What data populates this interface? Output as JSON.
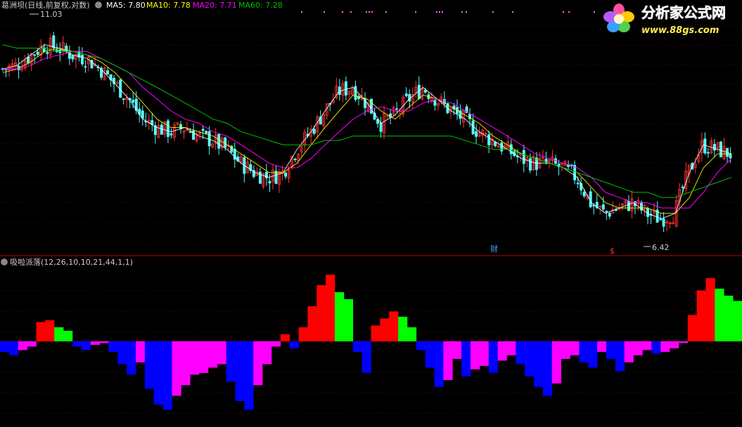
{
  "header": {
    "stock_title": "葛洲坝(日线,前复权,对数)",
    "ma5": "MA5: 7.80",
    "ma10": "MA10: 7.78",
    "ma20": "MA20: 7.71",
    "ma60": "MA60: 7.28"
  },
  "indicator": {
    "title": "吸啦派落(12,26,10,10,21,44,1,1)"
  },
  "annotations": {
    "high_label": "11.03",
    "low_label": "6.42",
    "event_cai": "财",
    "event_dollar": "$"
  },
  "logo": {
    "brand": "分析家公式网",
    "url": "www.88gs.com"
  },
  "colors": {
    "background": "#000000",
    "up_candle": "#ff3232",
    "down_candle": "#54ffff",
    "ma5": "#ffffff",
    "ma10": "#ffff00",
    "ma20": "#ff00ff",
    "ma60": "#00c000",
    "bar_red": "#ff0000",
    "bar_green": "#00ff00",
    "bar_blue": "#0000ff",
    "bar_magenta": "#ff00ff",
    "separator": "#c00000"
  },
  "chart_data": [
    {
      "type": "line",
      "panel": "price",
      "scale": "log",
      "ylim": [
        6.0,
        11.6
      ],
      "series": [
        {
          "name": "MA5",
          "values": [
            9.9,
            10.0,
            10.3,
            10.6,
            10.5,
            10.3,
            10.2,
            9.9,
            9.5,
            9.1,
            8.6,
            8.4,
            8.3,
            8.4,
            8.2,
            8.1,
            7.9,
            7.6,
            7.4,
            7.3,
            7.4,
            7.9,
            8.3,
            8.8,
            9.3,
            9.4,
            9.0,
            8.5,
            8.7,
            9.1,
            9.4,
            9.1,
            8.8,
            8.6,
            8.3,
            8.1,
            7.9,
            7.7,
            7.6,
            7.6,
            7.5,
            7.3,
            6.8,
            6.6,
            6.7,
            6.8,
            6.6,
            6.5,
            6.6,
            7.4,
            8.0,
            7.9,
            7.8
          ]
        },
        {
          "name": "MA10",
          "values": [
            9.8,
            9.9,
            10.1,
            10.4,
            10.5,
            10.4,
            10.3,
            10.1,
            9.8,
            9.4,
            9.0,
            8.6,
            8.4,
            8.4,
            8.3,
            8.2,
            8.0,
            7.8,
            7.6,
            7.4,
            7.4,
            7.6,
            8.0,
            8.4,
            8.8,
            9.2,
            9.1,
            8.8,
            8.6,
            8.9,
            9.2,
            9.1,
            8.9,
            8.7,
            8.5,
            8.2,
            8.0,
            7.8,
            7.7,
            7.6,
            7.5,
            7.4,
            7.1,
            6.8,
            6.7,
            6.7,
            6.7,
            6.6,
            6.6,
            6.9,
            7.5,
            7.8,
            7.8
          ]
        },
        {
          "name": "MA20",
          "values": [
            9.9,
            9.9,
            10.0,
            10.2,
            10.3,
            10.4,
            10.4,
            10.2,
            10.0,
            9.8,
            9.4,
            9.1,
            8.8,
            8.6,
            8.5,
            8.3,
            8.2,
            8.0,
            7.8,
            7.6,
            7.5,
            7.5,
            7.7,
            8.0,
            8.3,
            8.6,
            8.8,
            8.9,
            8.8,
            8.8,
            9.0,
            9.1,
            9.0,
            8.8,
            8.6,
            8.4,
            8.2,
            8.0,
            7.8,
            7.7,
            7.6,
            7.5,
            7.3,
            7.0,
            6.9,
            6.8,
            6.8,
            6.7,
            6.7,
            6.7,
            7.0,
            7.4,
            7.7
          ]
        },
        {
          "name": "MA60",
          "values": [
            10.6,
            10.5,
            10.5,
            10.5,
            10.4,
            10.4,
            10.3,
            10.2,
            10.0,
            9.8,
            9.6,
            9.4,
            9.2,
            9.0,
            8.8,
            8.6,
            8.5,
            8.3,
            8.2,
            8.1,
            8.0,
            8.0,
            8.0,
            8.1,
            8.1,
            8.2,
            8.2,
            8.2,
            8.2,
            8.2,
            8.2,
            8.2,
            8.2,
            8.1,
            8.0,
            7.9,
            7.9,
            7.8,
            7.7,
            7.6,
            7.5,
            7.4,
            7.3,
            7.2,
            7.1,
            7.0,
            7.0,
            6.9,
            6.9,
            7.0,
            7.1,
            7.2,
            7.3
          ]
        }
      ]
    },
    {
      "type": "bar",
      "panel": "indicator",
      "series": [
        {
          "name": "吸啦派落",
          "values": [
            -0.6,
            -0.8,
            -0.5,
            -0.3,
            1.1,
            1.2,
            0.8,
            0.6,
            -0.3,
            -0.5,
            -0.2,
            -0.1,
            -0.6,
            -1.3,
            -1.9,
            -1.2,
            -2.7,
            -3.6,
            -3.9,
            -3.1,
            -2.5,
            -1.9,
            -1.8,
            -1.5,
            -1.3,
            -2.3,
            -3.4,
            -3.9,
            -2.5,
            -1.3,
            -0.3,
            0.4,
            -0.4,
            0.8,
            2.0,
            3.2,
            3.8,
            2.8,
            2.4,
            -0.6,
            -1.8,
            0.9,
            1.3,
            1.7,
            1.4,
            0.8,
            -0.5,
            -1.5,
            -2.6,
            -2.2,
            -1.0,
            -2.0,
            -1.6,
            -1.4,
            -1.8,
            -1.1,
            -0.8,
            -1.3,
            -2.0,
            -2.6,
            -3.1,
            -2.4,
            -1.0,
            -0.8,
            -1.2,
            -1.5,
            -0.6,
            -1.0,
            -1.7,
            -1.2,
            -0.8,
            -0.5,
            -0.7,
            -0.6,
            -0.4,
            -0.1,
            1.5,
            2.9,
            3.6,
            3.0,
            2.6,
            2.3
          ]
        }
      ]
    }
  ]
}
